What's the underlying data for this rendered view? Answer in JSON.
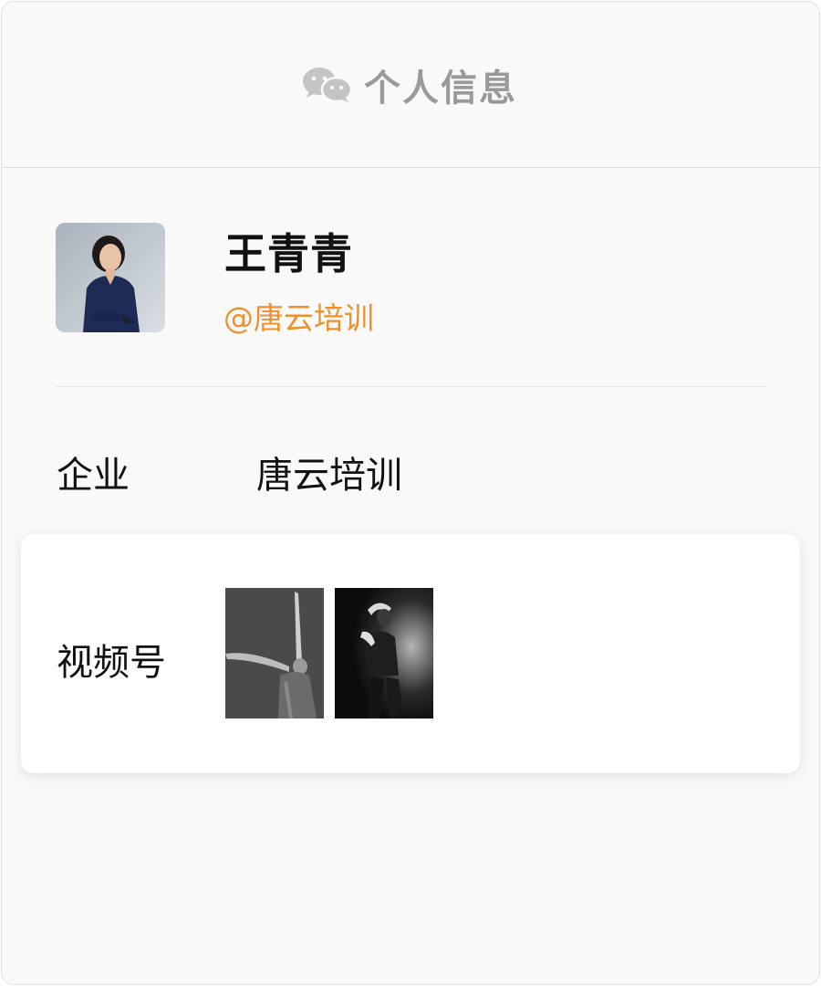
{
  "header": {
    "title": "个人信息",
    "icon": "wechat-icon"
  },
  "profile": {
    "name": "王青青",
    "handle": "@唐云培训",
    "avatar": "profile-photo"
  },
  "company": {
    "label": "企业",
    "value": "唐云培训"
  },
  "channels": {
    "label": "视频号",
    "thumbnails": [
      "dancer-thumbnail-1",
      "dancer-thumbnail-2"
    ]
  },
  "colors": {
    "accent": "#f0902a",
    "header_text": "#9a9a9a",
    "background": "#f9f9f9",
    "card": "#ffffff"
  }
}
